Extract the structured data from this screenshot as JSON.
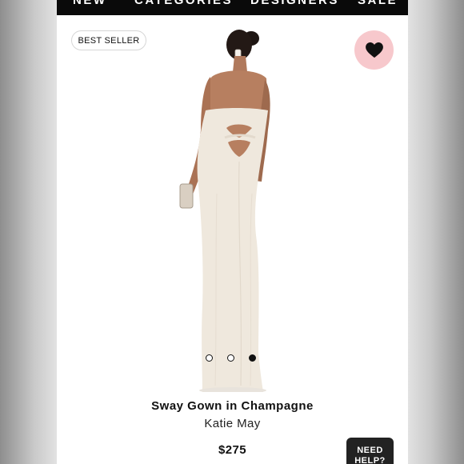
{
  "nav": {
    "items": [
      "NEW",
      "CATEGORIES",
      "DESIGNERS",
      "SALE"
    ]
  },
  "badge": {
    "label": "BEST SELLER"
  },
  "favorite": {
    "icon": "heart-icon",
    "bg_color": "#f7c8cc",
    "icon_color": "#111111"
  },
  "product": {
    "title": "Sway Gown in Champagne",
    "brand": "Katie May",
    "price": "$275",
    "gown_color": "#efe8dd"
  },
  "gallery": {
    "image_count": 3,
    "active_index": 2
  },
  "help": {
    "label": "NEED\nHELP?"
  }
}
